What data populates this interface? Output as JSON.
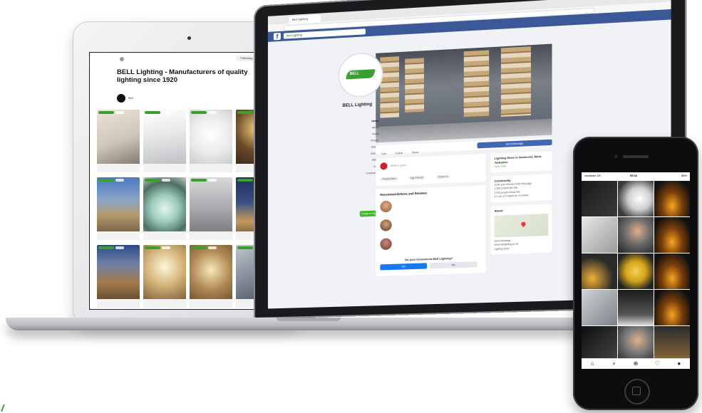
{
  "tablet": {
    "page_title": "BELL Lighting - Manufacturers of quality lighting since 1920",
    "follow_label": "Following",
    "account_name": "Bell"
  },
  "laptop": {
    "browser": {
      "tab_label": "Bell Lighting"
    },
    "facebook": {
      "logo": "f",
      "search_value": "Bell Lighting",
      "page_name": "BELL Lighting",
      "profile_logo_text": "BELL",
      "left_nav": [
        "Home",
        "About",
        "Posts",
        "Photos",
        "Videos",
        "Events",
        "Offers",
        "Jobs",
        "Community"
      ],
      "create_page_label": "Create a Page",
      "action_buttons": [
        "Like",
        "Follow",
        "Share"
      ],
      "send_message_label": "Send Message",
      "create_post_placeholder": "Write a post...",
      "create_post_buttons": [
        "Photo/Video",
        "Tag Friends",
        "Check in"
      ],
      "recommendations_title": "Recommendations and Reviews",
      "recommend_question": "Do you recommend Bell Lighting?",
      "recommend_yes": "Yes",
      "recommend_no": "No",
      "right_cards": [
        {
          "title": "Lighting Store in Somerset, West Yorkshire",
          "lines": [
            "Open Now"
          ]
        },
        {
          "title": "Community",
          "lines": [
            "Invite your friends to like this page",
            "2,362 people like this",
            "2,514 people follow this",
            "5.0 out of 5 based on 3 reviews"
          ]
        },
        {
          "title": "About",
          "lines": [
            "Send Message",
            "www.belllighting.co.uk",
            "Lighting Store"
          ]
        }
      ]
    }
  },
  "phone": {
    "status_left": "vodafone UK",
    "status_time": "09:31",
    "status_right": "88%",
    "tabbar_icons": [
      "home-icon",
      "search-icon",
      "add-icon",
      "heart-icon",
      "profile-icon"
    ],
    "tabbar_glyphs": [
      "⌂",
      "⌕",
      "⊕",
      "♡",
      "●"
    ]
  },
  "colors": {
    "facebook_blue": "#3b5998",
    "brand_green": "#3a9f2e",
    "like_blue": "#1877f2"
  }
}
